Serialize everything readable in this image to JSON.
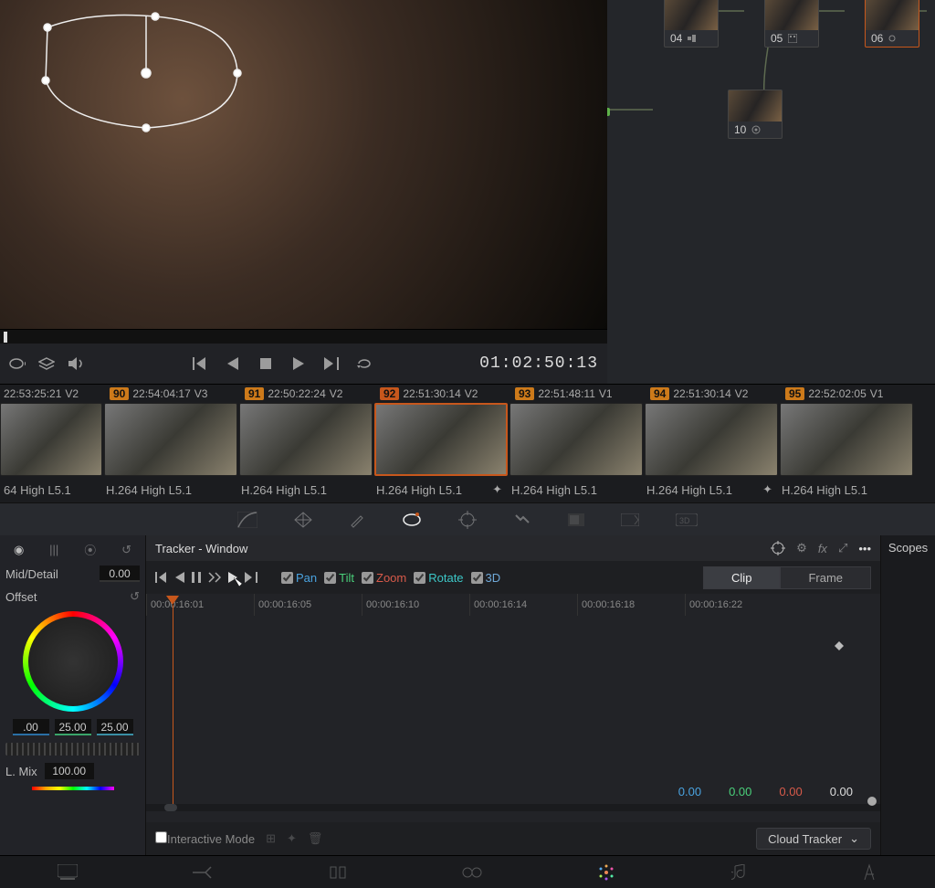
{
  "timecode": "01:02:50:13",
  "clips_meta": [
    {
      "tc": "22:53:25:21",
      "track": "V2",
      "idx": "90"
    },
    {
      "tc": "22:54:04:17",
      "track": "V3",
      "idx": "91"
    },
    {
      "tc": "22:50:22:24",
      "track": "V2",
      "idx": "92"
    },
    {
      "tc": "22:51:30:14",
      "track": "V2",
      "idx": "93"
    },
    {
      "tc": "22:51:48:11",
      "track": "V1",
      "idx": "94"
    },
    {
      "tc": "22:51:30:14",
      "track": "V2",
      "idx": "95"
    },
    {
      "tc": "22:52:02:05",
      "track": "V1",
      "idx": ""
    }
  ],
  "codec_label": "H.264 High L5.1",
  "codec_partial": "64 High L5.1",
  "nodes": [
    {
      "id": "04"
    },
    {
      "id": "05"
    },
    {
      "id": "06"
    },
    {
      "id": "10"
    }
  ],
  "panel_title": "Tracker - Window",
  "side": {
    "mode": "Mid/Detail",
    "mode_val": "0.00",
    "offset": "Offset",
    "nums": [
      ".00",
      "25.00",
      "25.00"
    ],
    "lmix_label": "L. Mix",
    "lmix_val": "100.00"
  },
  "track_opts": {
    "pan": "Pan",
    "tilt": "Tilt",
    "zoom": "Zoom",
    "rotate": "Rotate",
    "d3": "3D"
  },
  "seg": {
    "clip": "Clip",
    "frame": "Frame"
  },
  "ruler": [
    "00:00:16:01",
    "00:00:16:05",
    "00:00:16:10",
    "00:00:16:14",
    "00:00:16:18",
    "00:00:16:22"
  ],
  "readout": {
    "pan": "0.00",
    "tilt": "0.00",
    "zoom": "0.00",
    "rot": "0.00"
  },
  "interactive": "Interactive Mode",
  "tracker_select": "Cloud Tracker",
  "scopes": "Scopes"
}
